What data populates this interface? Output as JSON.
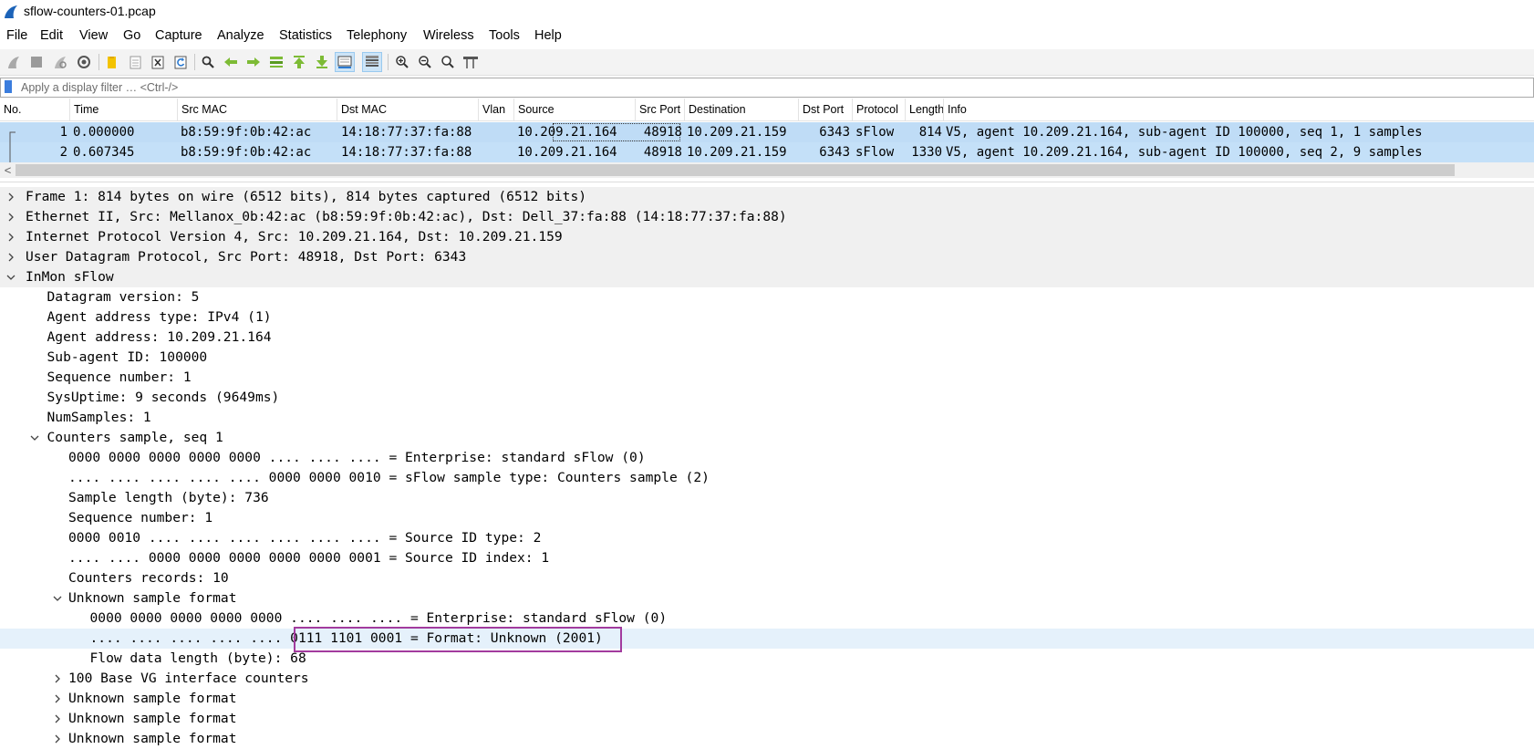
{
  "window": {
    "title": "sflow-counters-01.pcap"
  },
  "menu": [
    "File",
    "Edit",
    "View",
    "Go",
    "Capture",
    "Analyze",
    "Statistics",
    "Telephony",
    "Wireless",
    "Tools",
    "Help"
  ],
  "toolbar": {
    "icons": [
      "shark-start-icon",
      "stop-icon",
      "restart-icon",
      "options-gear-icon",
      "open-folder-icon",
      "save-file-icon",
      "close-file-icon",
      "reload-icon",
      "find-icon",
      "back-arrow-icon",
      "forward-arrow-icon",
      "go-to-packet-icon",
      "first-packet-icon",
      "last-packet-icon",
      "autoscroll-icon",
      "colorize-icon",
      "zoom-in-icon",
      "zoom-out-icon",
      "zoom-reset-icon",
      "resize-columns-icon"
    ]
  },
  "filter": {
    "placeholder": "Apply a display filter … <Ctrl-/>"
  },
  "packet_list": {
    "columns": [
      "No.",
      "Time",
      "Src MAC",
      "Dst MAC",
      "Vlan",
      "Source",
      "Src Port",
      "Destination",
      "Dst Port",
      "Protocol",
      "Length",
      "Info"
    ],
    "rows": [
      {
        "no": "1",
        "time": "0.000000",
        "src_mac": "b8:59:9f:0b:42:ac",
        "dst_mac": "14:18:77:37:fa:88",
        "vlan": "",
        "source": "10.209.21.164",
        "src_port": "48918",
        "destination": "10.209.21.159",
        "dst_port": "6343",
        "protocol": "sFlow",
        "length": "814",
        "info": "V5, agent 10.209.21.164, sub-agent ID 100000, seq 1, 1 samples"
      },
      {
        "no": "2",
        "time": "0.607345",
        "src_mac": "b8:59:9f:0b:42:ac",
        "dst_mac": "14:18:77:37:fa:88",
        "vlan": "",
        "source": "10.209.21.164",
        "src_port": "48918",
        "destination": "10.209.21.159",
        "dst_port": "6343",
        "protocol": "sFlow",
        "length": "1330",
        "info": "V5, agent 10.209.21.164, sub-agent ID 100000, seq 2, 9 samples"
      }
    ]
  },
  "scrollbar": {
    "left_arrow": "<"
  },
  "details": {
    "lines": [
      {
        "text": "Frame 1: 814 bytes on wire (6512 bits), 814 bytes captured (6512 bits)",
        "state": "collapsed"
      },
      {
        "text": "Ethernet II, Src: Mellanox_0b:42:ac (b8:59:9f:0b:42:ac), Dst: Dell_37:fa:88 (14:18:77:37:fa:88)",
        "state": "collapsed"
      },
      {
        "text": "Internet Protocol Version 4, Src: 10.209.21.164, Dst: 10.209.21.159",
        "state": "collapsed"
      },
      {
        "text": "User Datagram Protocol, Src Port: 48918, Dst Port: 6343",
        "state": "collapsed"
      },
      {
        "text": "InMon sFlow",
        "state": "expanded"
      },
      {
        "text": "Datagram version: 5",
        "state": "leaf"
      },
      {
        "text": "Agent address type: IPv4 (1)",
        "state": "leaf"
      },
      {
        "text": "Agent address: 10.209.21.164",
        "state": "leaf"
      },
      {
        "text": "Sub-agent ID: 100000",
        "state": "leaf"
      },
      {
        "text": "Sequence number: 1",
        "state": "leaf"
      },
      {
        "text": "SysUptime: 9 seconds (9649ms)",
        "state": "leaf"
      },
      {
        "text": "NumSamples: 1",
        "state": "leaf"
      },
      {
        "text": "Counters sample, seq 1",
        "state": "expanded"
      },
      {
        "text": "0000 0000 0000 0000 0000 .... .... .... = Enterprise: standard sFlow (0)",
        "state": "leaf"
      },
      {
        "text": ".... .... .... .... .... 0000 0000 0010 = sFlow sample type: Counters sample (2)",
        "state": "leaf"
      },
      {
        "text": "Sample length (byte): 736",
        "state": "leaf"
      },
      {
        "text": "Sequence number: 1",
        "state": "leaf"
      },
      {
        "text": "0000 0010 .... .... .... .... .... .... = Source ID type: 2",
        "state": "leaf"
      },
      {
        "text": ".... .... 0000 0000 0000 0000 0000 0001 = Source ID index: 1",
        "state": "leaf"
      },
      {
        "text": "Counters records: 10",
        "state": "leaf"
      },
      {
        "text": "Unknown sample format",
        "state": "expanded"
      },
      {
        "text": "0000 0000 0000 0000 0000 .... .... .... = Enterprise: standard sFlow (0)",
        "state": "leaf"
      },
      {
        "text": ".... .... .... .... .... 0111 1101 0001 = Format: Unknown (2001)",
        "state": "leaf"
      },
      {
        "text": "Flow data length (byte): 68",
        "state": "leaf"
      },
      {
        "text": "100 Base VG interface counters",
        "state": "collapsed"
      },
      {
        "text": "Unknown sample format",
        "state": "collapsed"
      },
      {
        "text": "Unknown sample format",
        "state": "collapsed"
      },
      {
        "text": "Unknown sample format",
        "state": "collapsed"
      }
    ]
  },
  "colors": {
    "row_selected": "#c4e0f8",
    "detail_highlight": "#e5f1fb",
    "annotation_box": "#a23b9e",
    "top_level_bg": "#f0f0f0"
  }
}
